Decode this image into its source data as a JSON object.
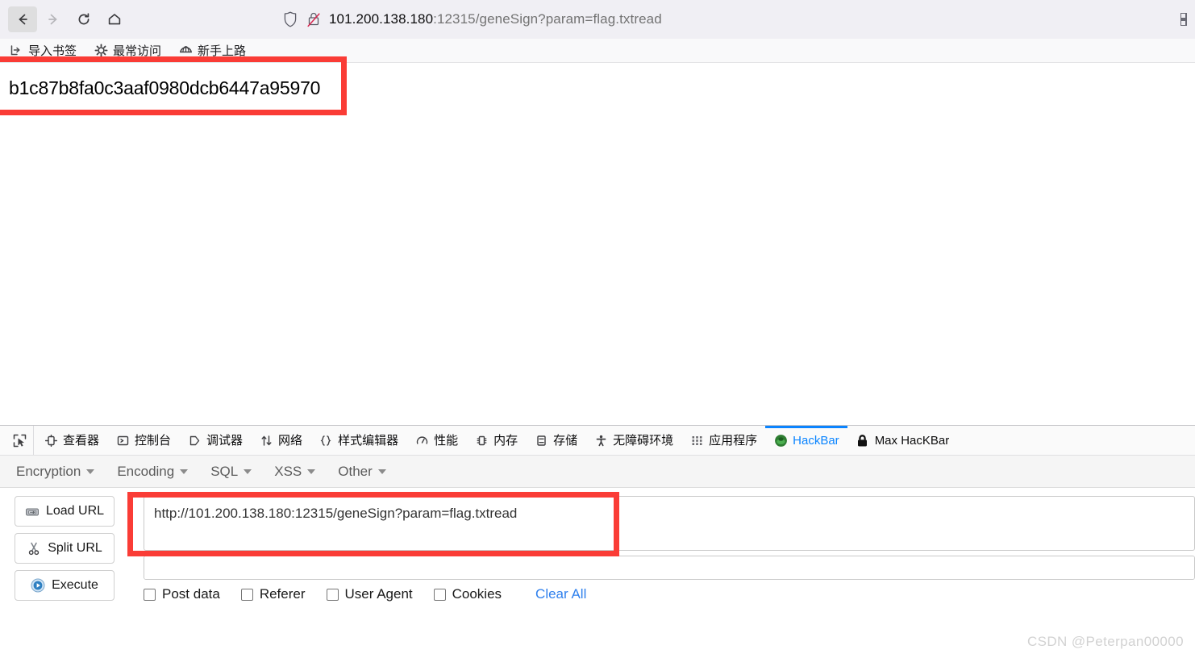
{
  "browser": {
    "nav": {
      "back_label": "Back",
      "forward_label": "Forward",
      "reload_label": "Reload",
      "home_label": "Home"
    },
    "url": {
      "host": "101.200.138.180",
      "rest": ":12315/geneSign?param=flag.txtread",
      "full": "101.200.138.180:12315/geneSign?param=flag.txtread",
      "shield_icon": "shield-icon",
      "lock_icon": "lock-slash-icon"
    },
    "bookmarks": [
      {
        "label": "导入书签",
        "icon": "import-bookmarks-icon"
      },
      {
        "label": "最常访问",
        "icon": "gear-icon"
      },
      {
        "label": "新手上路",
        "icon": "globe-icon"
      }
    ]
  },
  "page": {
    "body_text": "b1c87b8fa0c3aaf0980dcb6447a95970"
  },
  "devtools": {
    "picker_icon": "element-picker-icon",
    "tabs": [
      {
        "label": "查看器",
        "icon": "inspector-icon",
        "selected": false
      },
      {
        "label": "控制台",
        "icon": "console-icon",
        "selected": false
      },
      {
        "label": "调试器",
        "icon": "debugger-icon",
        "selected": false
      },
      {
        "label": "网络",
        "icon": "network-icon",
        "selected": false
      },
      {
        "label": "样式编辑器",
        "icon": "style-editor-icon",
        "selected": false
      },
      {
        "label": "性能",
        "icon": "performance-icon",
        "selected": false
      },
      {
        "label": "内存",
        "icon": "memory-icon",
        "selected": false
      },
      {
        "label": "存储",
        "icon": "storage-icon",
        "selected": false
      },
      {
        "label": "无障碍环境",
        "icon": "accessibility-icon",
        "selected": false
      },
      {
        "label": "应用程序",
        "icon": "application-icon",
        "selected": false
      },
      {
        "label": "HackBar",
        "icon": "hackbar-icon",
        "selected": true
      },
      {
        "label": "Max HacKBar",
        "icon": "lock-icon",
        "selected": false
      }
    ]
  },
  "hackbar": {
    "menus": [
      {
        "label": "Encryption"
      },
      {
        "label": "Encoding"
      },
      {
        "label": "SQL"
      },
      {
        "label": "XSS"
      },
      {
        "label": "Other"
      }
    ],
    "buttons": [
      {
        "label": "Load URL",
        "icon": "drive-icon"
      },
      {
        "label": "Split URL",
        "icon": "scissors-icon"
      },
      {
        "label": "Execute",
        "icon": "play-icon"
      }
    ],
    "url_value": "http://101.200.138.180:12315/geneSign?param=flag.txtread",
    "url_placeholder": "",
    "secondary_value": "",
    "secondary_placeholder": "",
    "checkboxes": [
      {
        "label": "Post data",
        "checked": false
      },
      {
        "label": "Referer",
        "checked": false
      },
      {
        "label": "User Agent",
        "checked": false
      },
      {
        "label": "Cookies",
        "checked": false
      }
    ],
    "clear_all_label": "Clear All"
  },
  "watermark": {
    "text": "CSDN @Peterpan00000"
  },
  "colors": {
    "accent_blue": "#0a84ff",
    "link_blue": "#2f80ed",
    "annotation_red": "#fa3c36",
    "chrome_bg": "#f0eff4"
  }
}
